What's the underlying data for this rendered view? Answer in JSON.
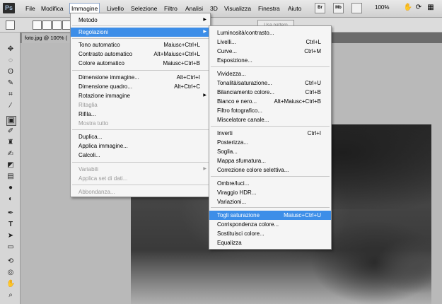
{
  "menubar": {
    "logo": "Ps",
    "items": [
      "File",
      "Modifica",
      "Immagine",
      "Livello",
      "Selezione",
      "Filtro",
      "Analisi",
      "3D",
      "Visualizza",
      "Finestra",
      "Aiuto"
    ],
    "tools": [
      "Br",
      "Mb"
    ],
    "zoom": "100%"
  },
  "optbar": {
    "pattern_label": "Usa pattern"
  },
  "doc_tab": {
    "title": "foto.jpg @ 100% ("
  },
  "icons": [
    "move-icon",
    "marquee-icon",
    "lasso-icon",
    "quick-select-icon",
    "crop-icon",
    "eyedropper-icon",
    "healing-icon",
    "brush-icon",
    "stamp-icon",
    "history-brush-icon",
    "eraser-icon",
    "gradient-icon",
    "blur-icon",
    "dodge-icon",
    "pen-icon",
    "type-icon",
    "path-select-icon",
    "shape-icon",
    "3d-rotate-icon",
    "3d-orbit-icon",
    "hand-icon",
    "zoom-icon"
  ],
  "immagine_menu": {
    "items": [
      {
        "label": "Metodo",
        "shortcut": "",
        "submenu": true
      },
      {
        "label": "Regolazioni",
        "shortcut": "",
        "submenu": true,
        "highlighted": true
      },
      {
        "label": "Tono automatico",
        "shortcut": "Maiusc+Ctrl+L"
      },
      {
        "label": "Contrasto automatico",
        "shortcut": "Alt+Maiusc+Ctrl+L"
      },
      {
        "label": "Colore automatico",
        "shortcut": "Maiusc+Ctrl+B"
      },
      {
        "label": "Dimensione immagine...",
        "shortcut": "Alt+Ctrl+I"
      },
      {
        "label": "Dimensione quadro...",
        "shortcut": "Alt+Ctrl+C"
      },
      {
        "label": "Rotazione immagine",
        "shortcut": "",
        "submenu": true
      },
      {
        "label": "Ritaglia",
        "shortcut": "",
        "disabled": true
      },
      {
        "label": "Rifila...",
        "shortcut": ""
      },
      {
        "label": "Mostra tutto",
        "shortcut": "",
        "disabled": true
      },
      {
        "label": "Duplica...",
        "shortcut": ""
      },
      {
        "label": "Applica immagine...",
        "shortcut": ""
      },
      {
        "label": "Calcoli...",
        "shortcut": ""
      },
      {
        "label": "Variabili",
        "shortcut": "",
        "submenu": true,
        "disabled": true
      },
      {
        "label": "Applica set di dati...",
        "shortcut": "",
        "disabled": true
      },
      {
        "label": "Abbondanza...",
        "shortcut": "",
        "disabled": true
      }
    ]
  },
  "regolazioni_menu": {
    "items": [
      {
        "label": "Luminosità/contrasto...",
        "shortcut": ""
      },
      {
        "label": "Livelli...",
        "shortcut": "Ctrl+L"
      },
      {
        "label": "Curve...",
        "shortcut": "Ctrl+M"
      },
      {
        "label": "Esposizione...",
        "shortcut": ""
      },
      {
        "label": "Vividezza...",
        "shortcut": ""
      },
      {
        "label": "Tonalità/saturazione...",
        "shortcut": "Ctrl+U"
      },
      {
        "label": "Bilanciamento colore...",
        "shortcut": "Ctrl+B"
      },
      {
        "label": "Bianco e nero...",
        "shortcut": "Alt+Maiusc+Ctrl+B"
      },
      {
        "label": "Filtro fotografico...",
        "shortcut": ""
      },
      {
        "label": "Miscelatore canale...",
        "shortcut": ""
      },
      {
        "label": "Inverti",
        "shortcut": "Ctrl+I"
      },
      {
        "label": "Posterizza...",
        "shortcut": ""
      },
      {
        "label": "Soglia...",
        "shortcut": ""
      },
      {
        "label": "Mappa sfumatura...",
        "shortcut": ""
      },
      {
        "label": "Correzione colore selettiva...",
        "shortcut": ""
      },
      {
        "label": "Ombre/luci...",
        "shortcut": ""
      },
      {
        "label": "Viraggio HDR...",
        "shortcut": ""
      },
      {
        "label": "Variazioni...",
        "shortcut": ""
      },
      {
        "label": "Togli saturazione",
        "shortcut": "Maiusc+Ctrl+U",
        "highlighted": true
      },
      {
        "label": "Corrispondenza colore...",
        "shortcut": ""
      },
      {
        "label": "Sostituisci colore...",
        "shortcut": ""
      },
      {
        "label": "Equalizza",
        "shortcut": ""
      }
    ]
  },
  "colors": {
    "highlight": "#3d8ee8",
    "menu_bg": "#f5f5f5",
    "disabled": "#9a9a9a"
  }
}
